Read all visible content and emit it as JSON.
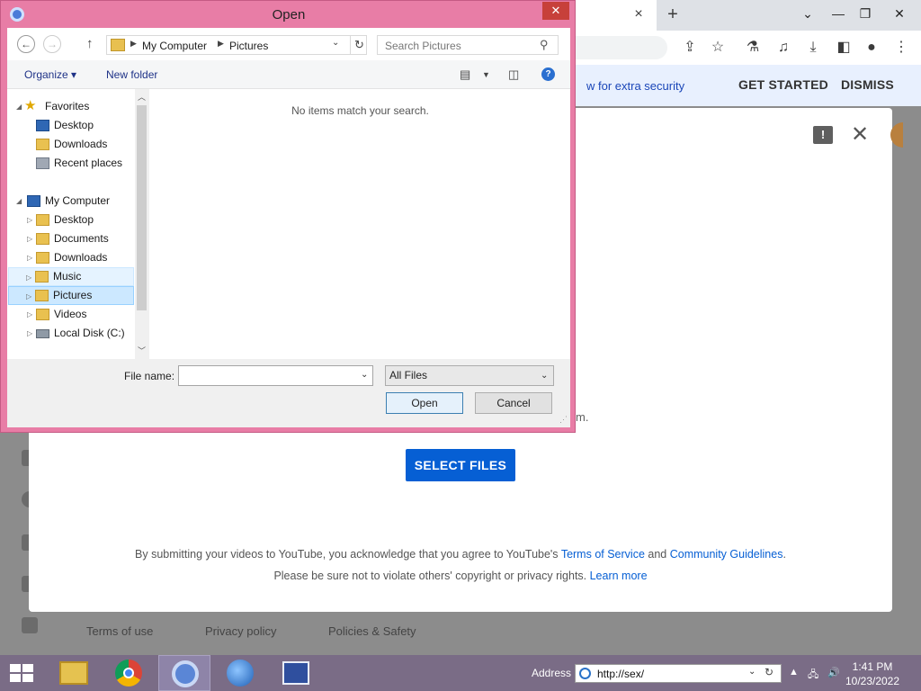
{
  "browser": {
    "tab_close": "×",
    "new_tab": "+",
    "banner_text": "w for extra security",
    "get_started": "GET STARTED",
    "dismiss": "DISMISS",
    "footer_links": [
      "Terms of use",
      "Privacy policy",
      "Policies & Safety"
    ]
  },
  "youtube": {
    "feedback_icon": "!",
    "close_icon": "✕",
    "hint_fragment": "m.",
    "select_files": "SELECT FILES",
    "terms_line1_prefix": "By submitting your videos to YouTube, you acknowledge that you agree to YouTube's ",
    "terms_of_service": "Terms of Service",
    "and": " and ",
    "community_guidelines": "Community Guidelines",
    "terms_line1_suffix": ".",
    "terms_line2_prefix": "Please be sure not to violate others' copyright or privacy rights. ",
    "learn_more": "Learn more"
  },
  "dialog": {
    "title": "Open",
    "close": "✕",
    "breadcrumb": [
      "My Computer",
      "Pictures"
    ],
    "search_placeholder": "Search Pictures",
    "organize": "Organize ▾",
    "new_folder": "New folder",
    "help": "?",
    "empty_message": "No items match your search.",
    "tree": [
      {
        "label": "Favorites",
        "icon": "star"
      },
      {
        "label": "Desktop",
        "icon": "desktop"
      },
      {
        "label": "Downloads",
        "icon": "folder"
      },
      {
        "label": "Recent places",
        "icon": "recent"
      },
      {
        "label": "My Computer",
        "icon": "pc"
      },
      {
        "label": "Desktop",
        "icon": "folder"
      },
      {
        "label": "Documents",
        "icon": "folder"
      },
      {
        "label": "Downloads",
        "icon": "folder"
      },
      {
        "label": "Music",
        "icon": "folder"
      },
      {
        "label": "Pictures",
        "icon": "folder"
      },
      {
        "label": "Videos",
        "icon": "folder"
      },
      {
        "label": "Local Disk (C:)",
        "icon": "disk"
      }
    ],
    "file_name_label": "File name:",
    "file_name_value": "",
    "file_type": "All Files",
    "open_button": "Open",
    "cancel_button": "Cancel"
  },
  "taskbar": {
    "address_label": "Address",
    "address_value": "http://sex/",
    "time": "1:41 PM",
    "date": "10/23/2022"
  }
}
